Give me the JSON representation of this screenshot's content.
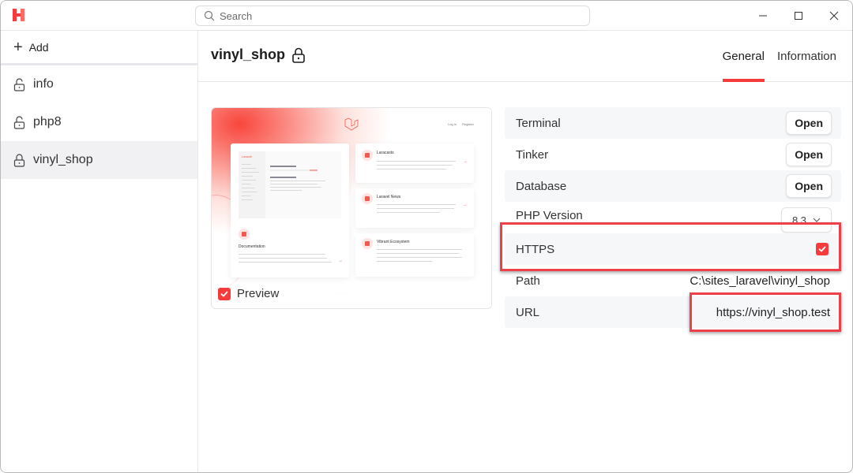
{
  "app": {
    "logo": "herd-logo-icon",
    "accent_color": "#f53b3b"
  },
  "titlebar": {
    "search_placeholder": "Search",
    "window_controls": [
      "minimize",
      "maximize",
      "close"
    ]
  },
  "sidebar": {
    "add_label": "Add",
    "sites": [
      {
        "name": "info",
        "secured": false,
        "active": false
      },
      {
        "name": "php8",
        "secured": false,
        "active": false
      },
      {
        "name": "vinyl_shop",
        "secured": true,
        "active": true
      }
    ]
  },
  "main": {
    "title": "vinyl_shop",
    "title_icon": "lock-icon",
    "tabs": [
      {
        "label": "General",
        "active": true
      },
      {
        "label": "Information",
        "active": false
      }
    ],
    "preview": {
      "label": "Preview",
      "checked": true,
      "thumbnail": {
        "nav_links": [
          "Log in",
          "Register"
        ],
        "cards": [
          {
            "title": "Documentation"
          },
          {
            "title": "Laracasts"
          },
          {
            "title": "Laravel News"
          },
          {
            "title": "Vibrant Ecosystem"
          }
        ],
        "doc_brand": "Laravel"
      }
    },
    "settings": [
      {
        "label": "Terminal",
        "type": "button",
        "button_label": "Open"
      },
      {
        "label": "Tinker",
        "type": "button",
        "button_label": "Open"
      },
      {
        "label": "Database",
        "type": "button",
        "button_label": "Open"
      },
      {
        "label": "PHP Version",
        "type": "select",
        "value": "8.3"
      },
      {
        "label": "HTTPS",
        "type": "checkbox",
        "checked": true
      },
      {
        "label": "Path",
        "type": "text",
        "value": "C:\\sites_laravel\\vinyl_shop"
      },
      {
        "label": "URL",
        "type": "text",
        "value": "https://vinyl_shop.test"
      }
    ]
  }
}
